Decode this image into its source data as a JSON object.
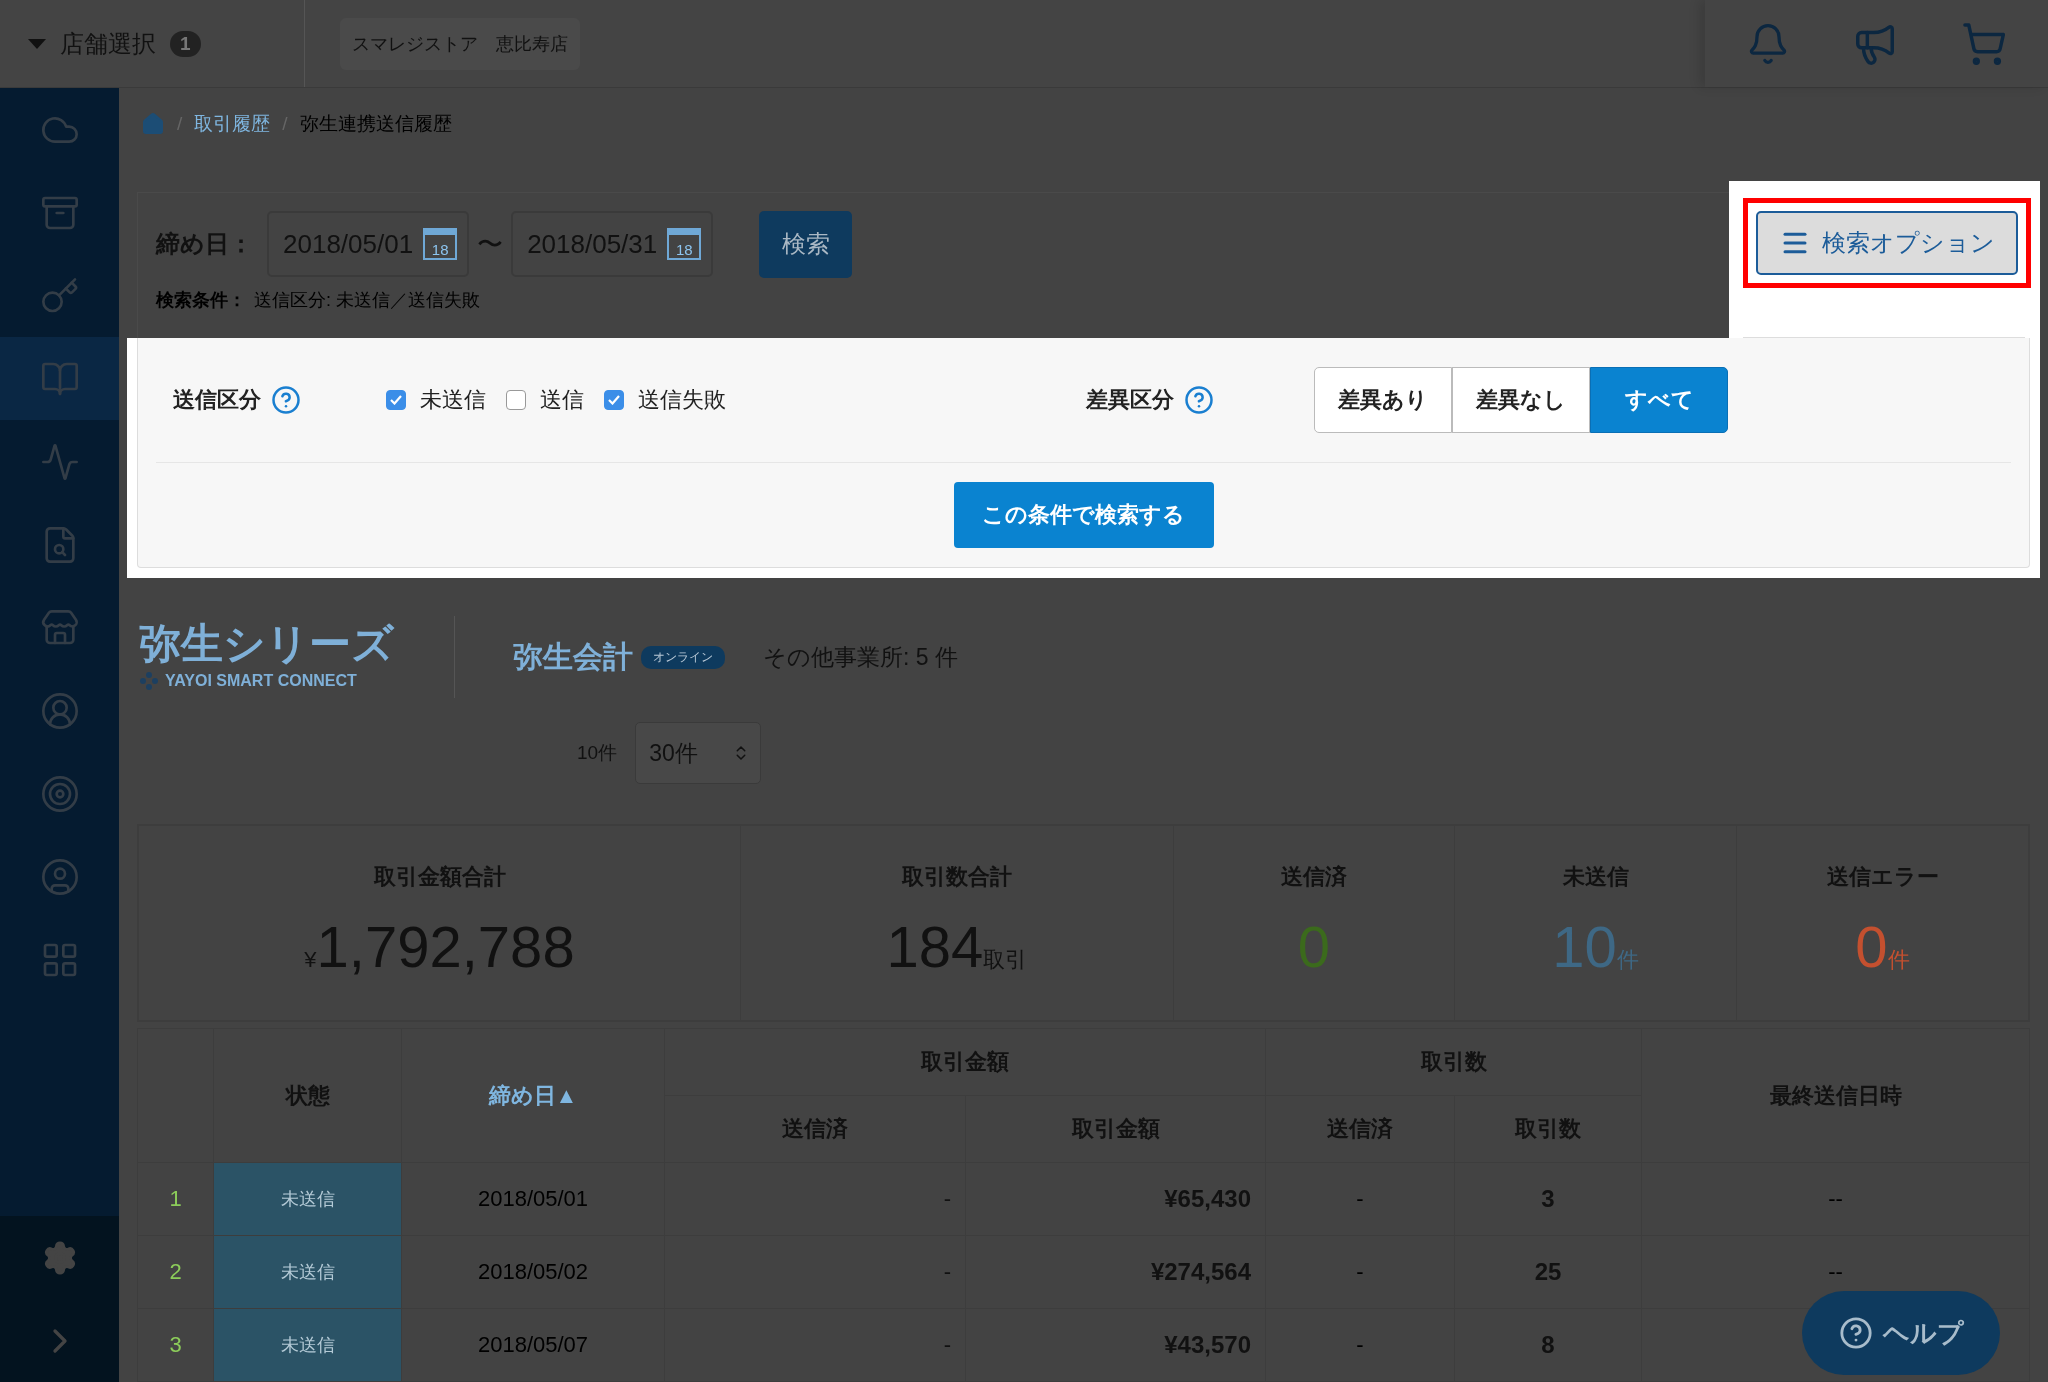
{
  "header": {
    "store_selector": {
      "label": "店舗選択",
      "badge": "1"
    },
    "store_name": "スマレジストア　恵比寿店"
  },
  "sidebar": {
    "items": [
      {
        "kind": "cloud",
        "selected": false
      },
      {
        "kind": "archive",
        "selected": false
      },
      {
        "kind": "key",
        "selected": false
      },
      {
        "kind": "book",
        "selected": true
      },
      {
        "kind": "chart",
        "selected": false
      },
      {
        "kind": "report",
        "selected": false
      },
      {
        "kind": "store",
        "selected": false
      },
      {
        "kind": "staff",
        "selected": false
      },
      {
        "kind": "target",
        "selected": false
      },
      {
        "kind": "user",
        "selected": false
      },
      {
        "kind": "grid",
        "selected": false
      }
    ]
  },
  "breadcrumb": [
    {
      "kind": "home"
    },
    {
      "kind": "separator",
      "label": "/"
    },
    {
      "kind": "link",
      "label": "取引履歴"
    },
    {
      "kind": "separator",
      "label": "/"
    },
    {
      "kind": "current",
      "label": "弥生連携送信履歴"
    }
  ],
  "filter": {
    "date_label": "締め日：",
    "date_from": "2018/05/01",
    "date_to": "2018/05/31",
    "date_from_calendar_day": "18",
    "date_to_calendar_day": "18",
    "range_sep": "〜",
    "search_button": "検索",
    "conditions_label": "検索条件：",
    "conditions": "送信区分: 未送信／送信失敗",
    "options_button": "検索オプション"
  },
  "options": {
    "send_label": "送信区分",
    "send_choices": [
      {
        "label": "未送信",
        "checked": true
      },
      {
        "label": "送信",
        "checked": false
      },
      {
        "label": "送信失敗",
        "checked": true
      }
    ],
    "diff_label": "差異区分",
    "diff_choices": [
      {
        "label": "差異あり",
        "selected": false
      },
      {
        "label": "差異なし",
        "selected": false
      },
      {
        "label": "すべて",
        "selected": true
      }
    ],
    "submit": "この条件で検索する"
  },
  "yayoi": {
    "logo_title": "弥生シリーズ",
    "logo_sub": "YAYOI SMART CONNECT",
    "product": "弥生会計",
    "product_badge": "オンライン",
    "other": "その他事業所: 5 件"
  },
  "paging": {
    "label": "10件",
    "select": "30件"
  },
  "summary": [
    {
      "title": "取引金額合計",
      "prefix": "¥",
      "value": "1,792,788",
      "color": "#111111"
    },
    {
      "title": "取引数合計",
      "value": "184",
      "unit": "取引",
      "color": "#111111"
    },
    {
      "title": "送信済",
      "value": "0",
      "color": "#3b6a1c"
    },
    {
      "title": "未送信",
      "value": "10",
      "unit": "件",
      "color": "#3e6885"
    },
    {
      "title": "送信エラー",
      "value": "0",
      "unit": "件",
      "color": "#c4502f"
    }
  ],
  "table": {
    "headers": {
      "status": "状態",
      "date": "締め日▲",
      "amount_group": "取引金額",
      "count_group": "取引数",
      "last_sent": "最終送信日時",
      "sent_amount": "送信済",
      "amount": "取引金額",
      "sent_count": "送信済",
      "count": "取引数"
    },
    "rows": [
      {
        "no": "1",
        "status": "未送信",
        "date": "2018/05/01",
        "sent_amount": "-",
        "amount": "¥65,430",
        "sent_count": "-",
        "count": "3",
        "last_sent": "--"
      },
      {
        "no": "2",
        "status": "未送信",
        "date": "2018/05/02",
        "sent_amount": "-",
        "amount": "¥274,564",
        "sent_count": "-",
        "count": "25",
        "last_sent": "--"
      },
      {
        "no": "3",
        "status": "未送信",
        "date": "2018/05/07",
        "sent_amount": "-",
        "amount": "¥43,570",
        "sent_count": "-",
        "count": "8"
      }
    ]
  },
  "help_button": "ヘルプ"
}
